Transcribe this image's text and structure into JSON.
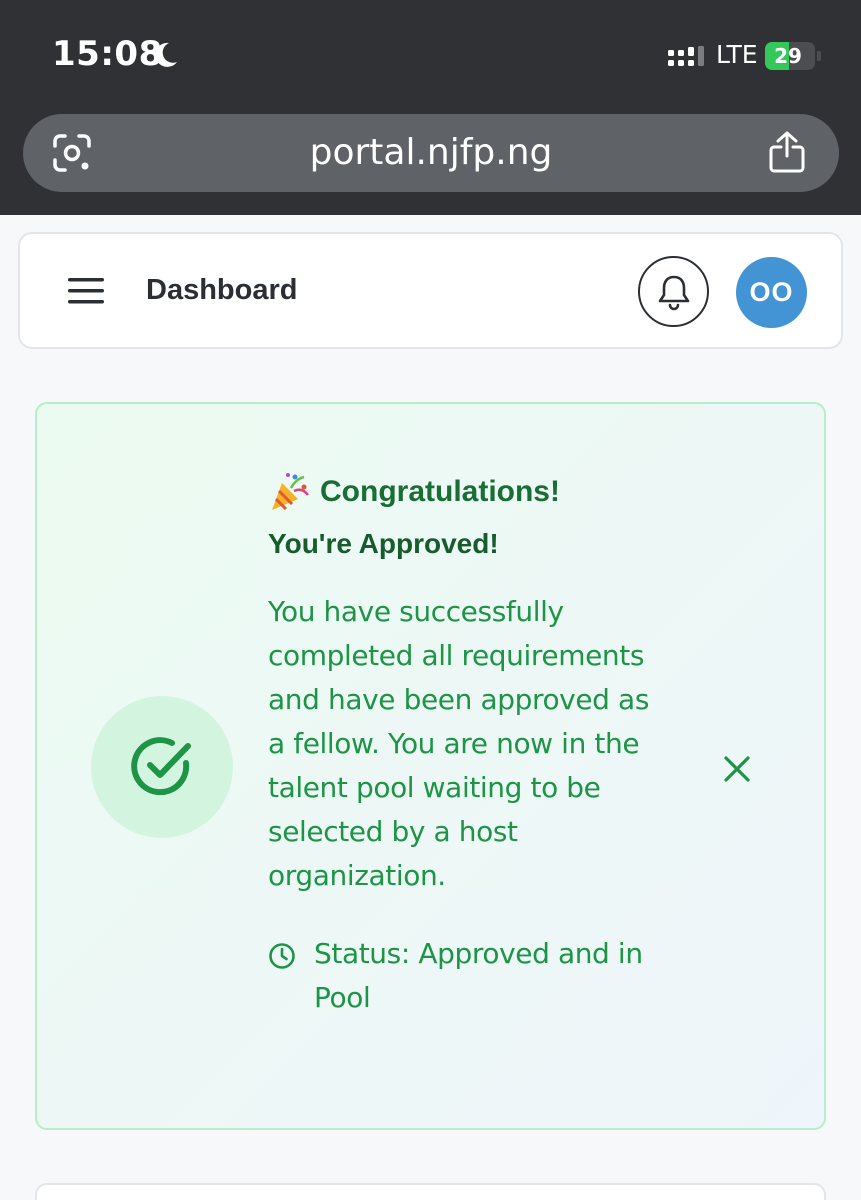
{
  "status_bar": {
    "time": "15:08",
    "network": "LTE",
    "battery": "29",
    "battery_level_percent": 29,
    "icons": [
      "moon-icon",
      "signal-icon",
      "battery-charging-icon"
    ]
  },
  "browser": {
    "url": "portal.njfp.ng",
    "icons": [
      "lens-icon",
      "share-icon"
    ]
  },
  "header": {
    "title": "Dashboard",
    "avatar_initials": "OO",
    "icons": [
      "menu-icon",
      "bell-icon"
    ]
  },
  "approval": {
    "headline": "Congratulations!",
    "subheadline": "You're Approved!",
    "message": "You have successfully completed all requirements and have been approved as a fellow. You are now in the talent pool waiting to be selected by a host organization.",
    "status": "Status: Approved and in Pool",
    "icons": [
      "party-popper-icon",
      "check-circle-icon",
      "close-icon",
      "clock-icon"
    ]
  },
  "colors": {
    "chrome_background": "#2f3134",
    "url_bar": "#5f6266",
    "avatar": "#4294d4",
    "success_green": "#1e9447",
    "success_dark": "#185c2e",
    "card_border": "#b9ecca"
  }
}
